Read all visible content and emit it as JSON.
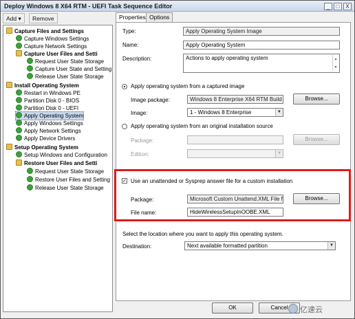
{
  "window": {
    "title": "Deploy Windows 8 X64 RTM - UEFI Task Sequence Editor",
    "controls": [
      "_",
      "□",
      "X"
    ]
  },
  "toolbar": {
    "add_label": "Add ▾",
    "remove_label": "Remove"
  },
  "tree": {
    "items": [
      {
        "label": "Capture Files and Settings",
        "kind": "group",
        "level": 0
      },
      {
        "label": "Capture Windows Settings",
        "kind": "step",
        "level": 1
      },
      {
        "label": "Capture Network Settings",
        "kind": "step",
        "level": 1
      },
      {
        "label": "Capture User Files and Setti",
        "kind": "group",
        "level": 1
      },
      {
        "label": "Request User State Storage",
        "kind": "step",
        "level": 2
      },
      {
        "label": "Capture User State and Setting",
        "kind": "step",
        "level": 2
      },
      {
        "label": "Release User State Storage",
        "kind": "step",
        "level": 2
      },
      {
        "label": "Install Operating System",
        "kind": "group",
        "level": 0
      },
      {
        "label": "Restart in Windows PE",
        "kind": "step",
        "level": 1
      },
      {
        "label": "Partition Disk 0 - BIOS",
        "kind": "step",
        "level": 1
      },
      {
        "label": "Partition Disk 0 - UEFI",
        "kind": "step",
        "level": 1
      },
      {
        "label": "Apply Operating System",
        "kind": "step",
        "level": 1,
        "selected": true
      },
      {
        "label": "Apply Windows Settings",
        "kind": "step",
        "level": 1
      },
      {
        "label": "Apply Network Settings",
        "kind": "step",
        "level": 1
      },
      {
        "label": "Apply Device Drivers",
        "kind": "step",
        "level": 1
      },
      {
        "label": "Setup Operating System",
        "kind": "group",
        "level": 0
      },
      {
        "label": "Setup Windows and Configuration",
        "kind": "step",
        "level": 1
      },
      {
        "label": "Restore User Files and Setti",
        "kind": "group",
        "level": 1
      },
      {
        "label": "Request User State Storage",
        "kind": "step",
        "level": 2
      },
      {
        "label": "Restore User Files and Setting",
        "kind": "step",
        "level": 2
      },
      {
        "label": "Release User State Storage",
        "kind": "step",
        "level": 2
      }
    ]
  },
  "tabs": {
    "properties": "Properties",
    "options": "Options"
  },
  "props": {
    "type_label": "Type:",
    "type_value": "Apply Operating System Image",
    "name_label": "Name:",
    "name_value": "Apply Operating System",
    "desc_label": "Description:",
    "desc_value": "Actions to apply operating system"
  },
  "captured": {
    "radio_label": "Apply operating system from a captured image",
    "package_label": "Image package:",
    "package_value": "Windows 8 Enterprise X64 RTM Build 9",
    "image_label": "Image:",
    "image_value": "1 - Windows 8 Enterprise",
    "browse_label": "Browse..."
  },
  "original": {
    "radio_label": "Apply operating system from an original installation source",
    "package_label": "Package:",
    "edition_label": "Edition:",
    "browse_label": "Browse..."
  },
  "answer": {
    "checkbox_label": "Use an unattended or Sysprep answer file for a custom installation",
    "package_label": "Package:",
    "package_value": "Microsoft Custom Unattend.XML File  fo",
    "filename_label": "File name:",
    "filename_value": "HideWirelessSetupInOOBE.XML",
    "browse_label": "Browse..."
  },
  "destination": {
    "hint": "Select the location where you want to apply this operating system.",
    "label": "Destination:",
    "value": "Next available formatted partition"
  },
  "footer": {
    "ok_label": "OK",
    "cancel_label": "Cancel"
  },
  "watermark": {
    "text": "亿速云"
  },
  "colors": {
    "highlight": "#e01b1b",
    "selection": "#c9d9ef"
  }
}
